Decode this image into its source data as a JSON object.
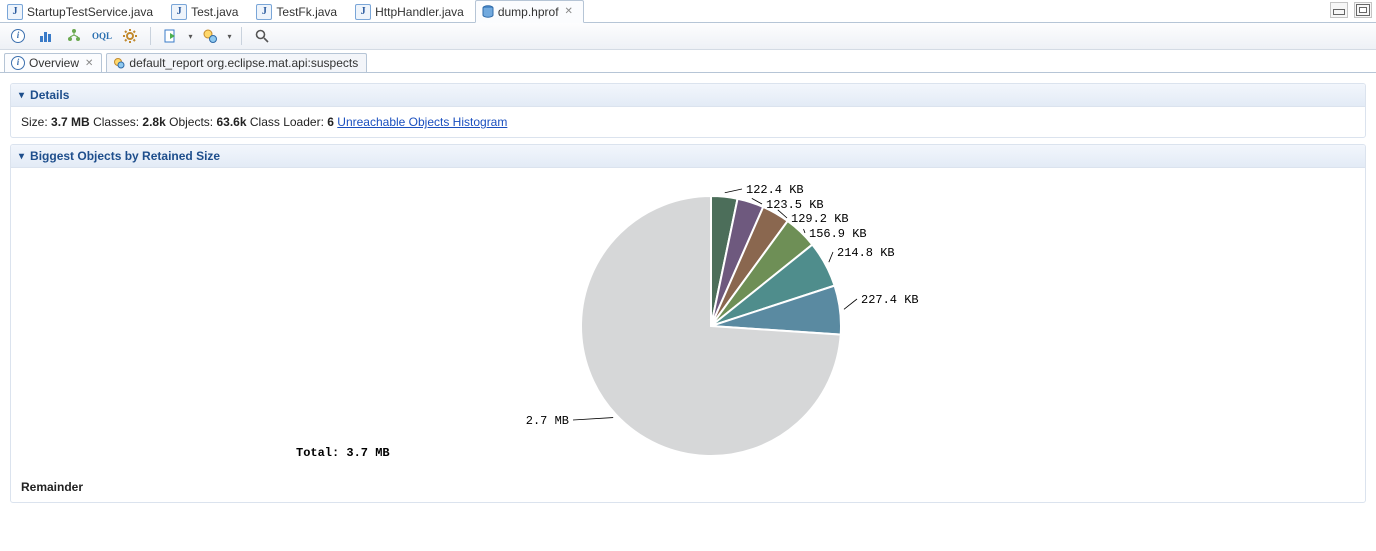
{
  "editor_tabs": [
    {
      "icon": "j",
      "label": "StartupTestService.java"
    },
    {
      "icon": "j",
      "label": "Test.java"
    },
    {
      "icon": "j",
      "label": "TestFk.java"
    },
    {
      "icon": "j",
      "label": "HttpHandler.java"
    },
    {
      "icon": "db",
      "label": "dump.hprof",
      "active": true,
      "closable": true
    }
  ],
  "toolbar_icons": [
    "info-icon",
    "histogram-icon",
    "dominator-tree-icon",
    "oql-icon",
    "settings-icon",
    "sep",
    "run-report-icon",
    "dd",
    "query-tools-icon",
    "dd",
    "sep",
    "search-icon"
  ],
  "view_tabs": [
    {
      "icon": "info",
      "label": "Overview",
      "closable": true,
      "active": true
    },
    {
      "icon": "report",
      "label": "default_report  org.eclipse.mat.api:suspects"
    }
  ],
  "sections": {
    "details": {
      "title": "Details",
      "size_label": "Size:",
      "size_value": "3.7 MB",
      "classes_label": "Classes:",
      "classes_value": "2.8k",
      "objects_label": "Objects:",
      "objects_value": "63.6k",
      "classloader_label": "Class Loader:",
      "classloader_value": "6",
      "hist_link": "Unreachable Objects Histogram"
    },
    "biggest": {
      "title": "Biggest Objects by Retained Size",
      "remainder_label": "Remainder",
      "total_prefix": "Total:",
      "total_value": "3.7 MB"
    }
  },
  "chart_data": {
    "type": "pie",
    "title": "Biggest Objects by Retained Size",
    "total_label": "Total: 3.7 MB",
    "slices": [
      {
        "label": "227.4 KB",
        "value_kb": 227.4,
        "color": "#5a8aa1"
      },
      {
        "label": "214.8 KB",
        "value_kb": 214.8,
        "color": "#4f8d8c"
      },
      {
        "label": "156.9 KB",
        "value_kb": 156.9,
        "color": "#6e8f56"
      },
      {
        "label": "129.2 KB",
        "value_kb": 129.2,
        "color": "#8a674f"
      },
      {
        "label": "123.5 KB",
        "value_kb": 123.5,
        "color": "#6e597e"
      },
      {
        "label": "122.4 KB",
        "value_kb": 122.4,
        "color": "#4c6e5a"
      },
      {
        "label": "2.7 MB",
        "value_kb": 2764.8,
        "color": "#d6d7d8",
        "is_remainder": true
      }
    ]
  }
}
